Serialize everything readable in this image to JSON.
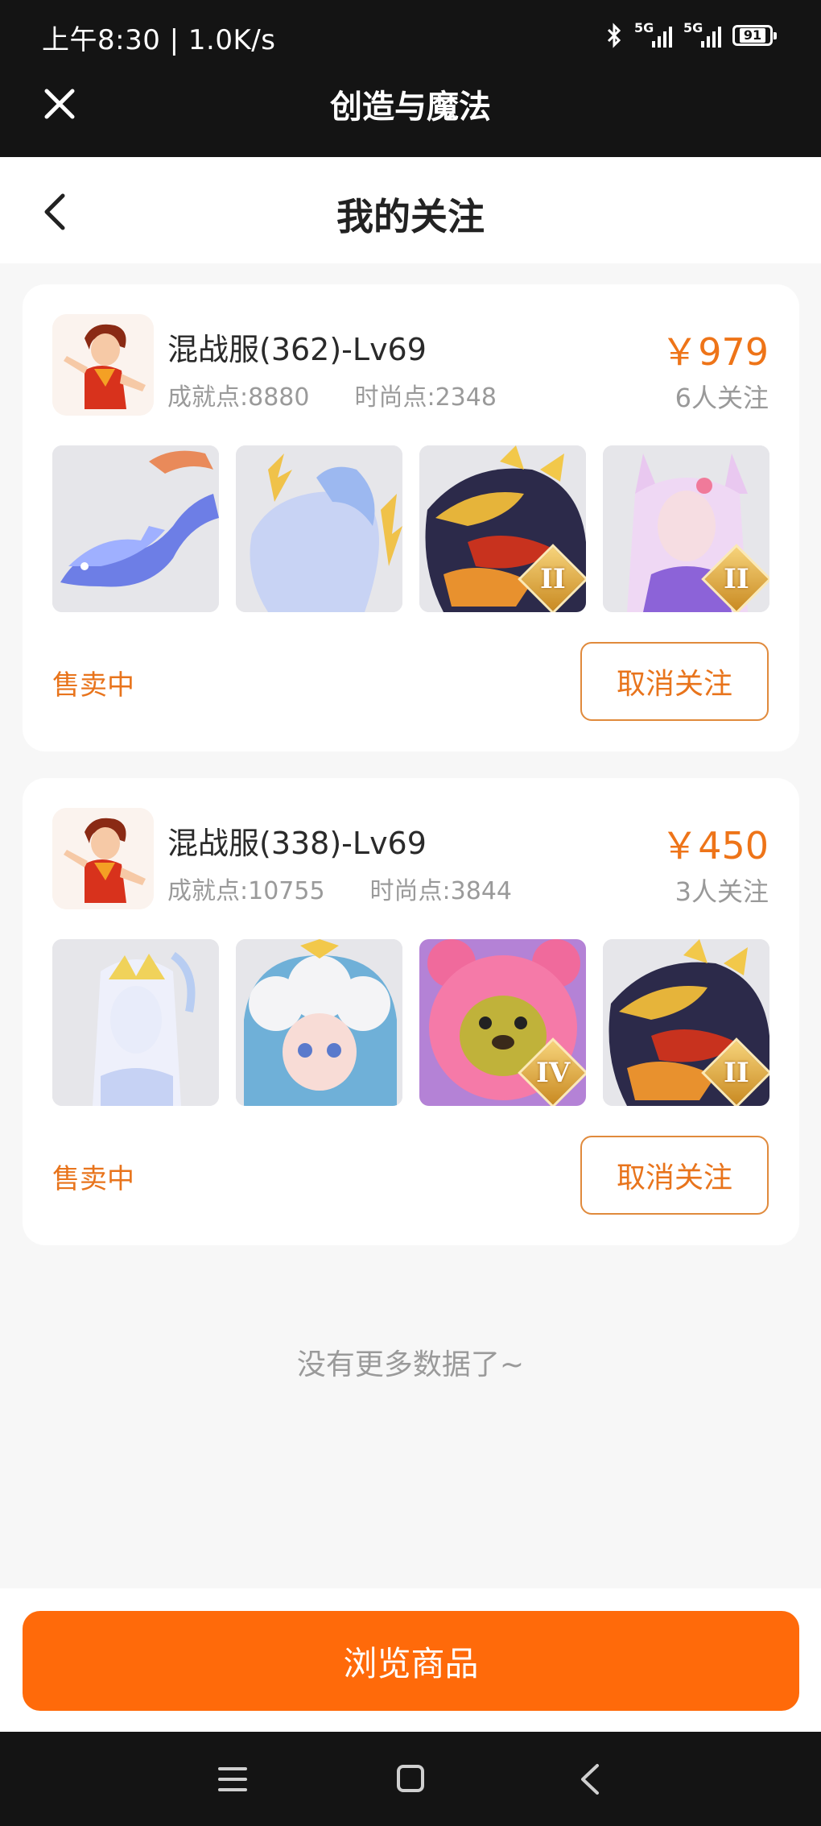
{
  "status_bar": {
    "time_speed": "上午8:30 | 1.0K/s",
    "signal1": "5G",
    "signal2": "5G",
    "battery": "91"
  },
  "app": {
    "title": "创造与魔法"
  },
  "page": {
    "title": "我的关注"
  },
  "items": [
    {
      "server": "混战服(362)-Lv69",
      "achievement": "成就点:8880",
      "fashion": "时尚点:2348",
      "price": "￥979",
      "followers": "6人关注",
      "tiers": [
        "",
        "",
        "II",
        "II"
      ],
      "status": "售卖中",
      "unfollow_label": "取消关注"
    },
    {
      "server": "混战服(338)-Lv69",
      "achievement": "成就点:10755",
      "fashion": "时尚点:3844",
      "price": "￥450",
      "followers": "3人关注",
      "tiers": [
        "",
        "",
        "IV",
        "II"
      ],
      "status": "售卖中",
      "unfollow_label": "取消关注"
    }
  ],
  "footer": {
    "no_more": "没有更多数据了~",
    "browse_label": "浏览商品"
  },
  "colors": {
    "accent": "#ff6a0a",
    "price": "#ee7418",
    "header_bg": "#141414"
  }
}
